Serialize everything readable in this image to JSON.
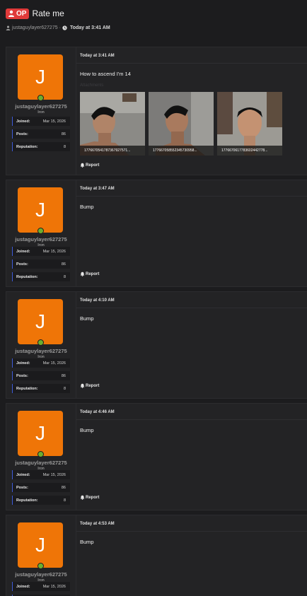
{
  "thread": {
    "op_badge": "OP",
    "title": "Rate me",
    "author": "justaguylayer627275",
    "separator": "·",
    "time": "Today at 3:41 AM"
  },
  "user": {
    "avatar_letter": "J",
    "username": "justaguylayer627275",
    "rank": "Iron",
    "joined_label": "Joined:",
    "joined": "Mar 15, 2026",
    "posts_label": "Posts:",
    "posts": "86",
    "reputation_label": "Reputation:",
    "reputation": "8"
  },
  "report_label": "Report",
  "posts": [
    {
      "time": "Today at 3:41 AM",
      "body": "How to ascend I'm 14",
      "attachments_label": "Attachments",
      "attachments": [
        "1776670541787367927571...",
        "177667058552345730958...",
        "1776670617783602442778..."
      ]
    },
    {
      "time": "Today at 3:47 AM",
      "body": "Bump"
    },
    {
      "time": "Today at 4:10 AM",
      "body": "Bump"
    },
    {
      "time": "Today at 4:46 AM",
      "body": "Bump"
    },
    {
      "time": "Today at 4:53 AM",
      "body": "Bump"
    }
  ],
  "colors": {
    "background": "#1c1c1e",
    "post_bg": "#232325",
    "avatar": "#ef7507",
    "op_badge": "#e03a3a",
    "online": "#6cae2f",
    "stat_border": "#3e5bd9"
  }
}
